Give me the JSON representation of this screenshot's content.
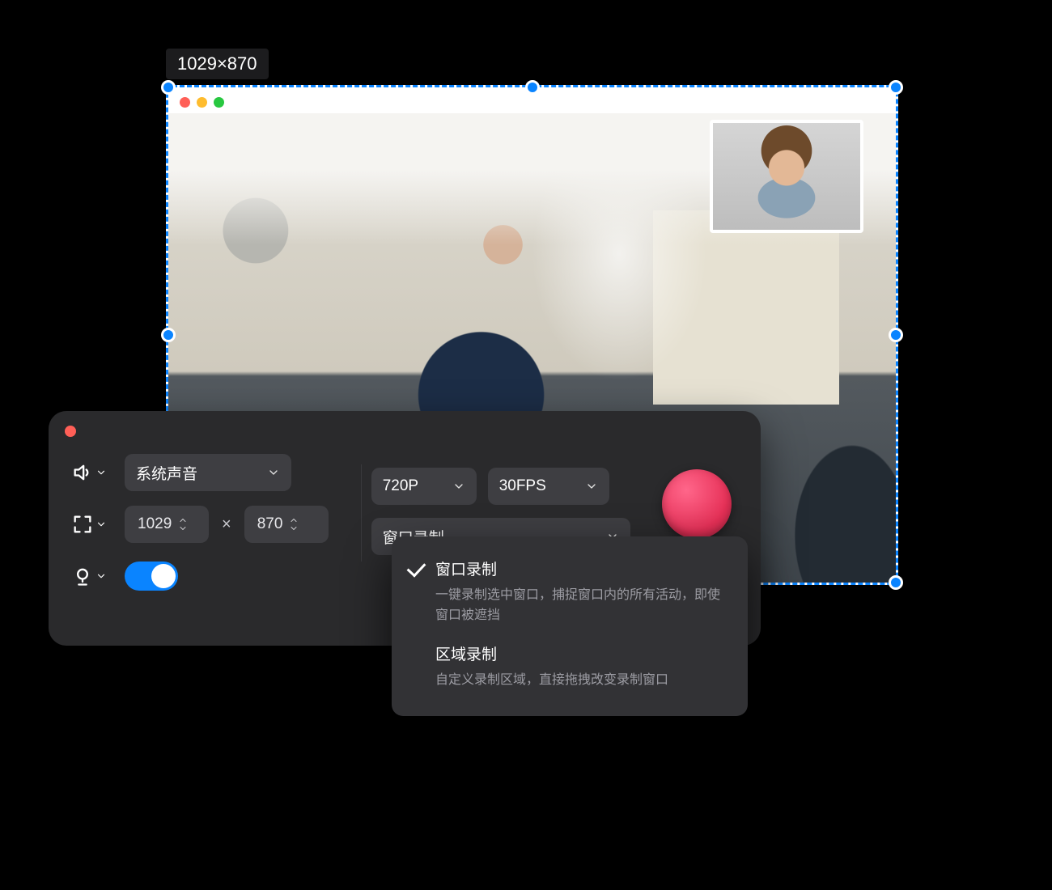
{
  "capture": {
    "dimensions_label": "1029×870",
    "width": "1029",
    "height": "870"
  },
  "panel": {
    "audio": {
      "label": "系统声音"
    },
    "resolution": {
      "label": "720P"
    },
    "fps": {
      "label": "30FPS"
    },
    "mode": {
      "label": "窗口录制"
    },
    "size": {
      "width": "1029",
      "height": "870"
    },
    "camera_on": true
  },
  "dropdown": {
    "items": [
      {
        "title": "窗口录制",
        "desc": "一键录制选中窗口，捕捉窗口内的所有活动，即使窗口被遮挡",
        "selected": true
      },
      {
        "title": "区域录制",
        "desc": "自定义录制区域，直接拖拽改变录制窗口",
        "selected": false
      }
    ]
  }
}
